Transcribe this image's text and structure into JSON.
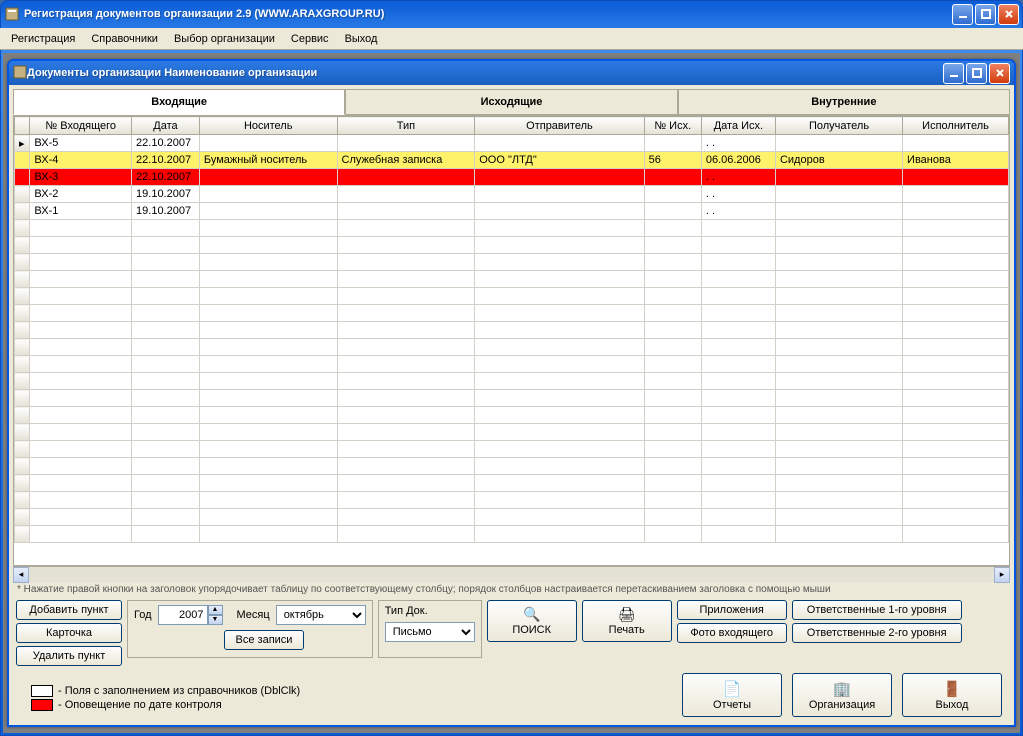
{
  "outer": {
    "title": "Регистрация документов организации 2.9 (WWW.ARAXGROUP.RU)"
  },
  "menubar": [
    "Регистрация",
    "Справочники",
    "Выбор организации",
    "Сервис",
    "Выход"
  ],
  "inner": {
    "title": "Документы организации Наименование организации"
  },
  "tabs": [
    "Входящие",
    "Исходящие",
    "Внутренние"
  ],
  "columns": [
    "№ Входящего",
    "Дата",
    "Носитель",
    "Тип",
    "Отправитель",
    "№ Исх.",
    "Дата Исх.",
    "Получатель",
    "Исполнитель"
  ],
  "rows": [
    {
      "style": "",
      "cells": [
        "ВХ-5",
        "22.10.2007",
        "",
        "",
        "",
        "",
        ". .",
        "",
        ""
      ]
    },
    {
      "style": "yellow",
      "cells": [
        "ВХ-4",
        "22.10.2007",
        "Бумажный носитель",
        "Служебная записка",
        "ООО \"ЛТД\"",
        "56",
        "06.06.2006",
        "Сидоров",
        "Иванова"
      ]
    },
    {
      "style": "red",
      "cells": [
        "ВХ-3",
        "22.10.2007",
        "",
        "",
        "",
        "",
        ". .",
        "",
        ""
      ]
    },
    {
      "style": "",
      "cells": [
        "ВХ-2",
        "19.10.2007",
        "",
        "",
        "",
        "",
        ". .",
        "",
        ""
      ]
    },
    {
      "style": "",
      "cells": [
        "ВХ-1",
        "19.10.2007",
        "",
        "",
        "",
        "",
        ". .",
        "",
        ""
      ]
    }
  ],
  "hint": "* Нажатие правой кнопки на заголовок упорядочивает таблицу по соответствующему столбцу;  порядок столбцов настраивается перетаскиванием заголовка с помощью мыши",
  "left_buttons": [
    "Добавить пункт",
    "Карточка",
    "Удалить пункт"
  ],
  "filters": {
    "year_label": "Год",
    "year_value": "2007",
    "month_label": "Месяц",
    "month_value": "октябрь",
    "all_records": "Все записи",
    "doctype_label": "Тип Док.",
    "doctype_value": "Письмо"
  },
  "action_buttons": {
    "search": "ПОИСК",
    "print": "Печать"
  },
  "right_buttons": {
    "attachments": "Приложения",
    "photo": "Фото входящего",
    "resp1": "Ответственные 1-го уровня",
    "resp2": "Ответственные 2-го уровня"
  },
  "legend": {
    "white": "- Поля с заполнением из справочников (DblClk)",
    "red": "- Оповещение по дате контроля"
  },
  "footer": {
    "reports": "Отчеты",
    "org": "Организация",
    "exit": "Выход"
  }
}
